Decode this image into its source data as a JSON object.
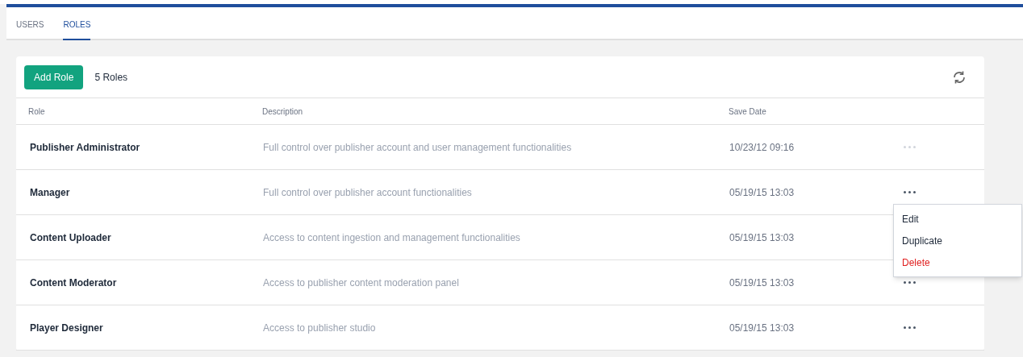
{
  "tabs": [
    {
      "label": "USERS",
      "selected": false
    },
    {
      "label": "ROLES",
      "selected": true
    }
  ],
  "toolbar": {
    "add_button": "Add Role",
    "count": "5 Roles"
  },
  "table": {
    "columns": [
      "Role",
      "Description",
      "Save Date"
    ],
    "rows": [
      {
        "role": "Publisher Administrator",
        "description": "Full control over publisher account and user management functionalities",
        "save_date": "10/23/12 09:16",
        "actions_disabled": true
      },
      {
        "role": "Manager",
        "description": "Full control over publisher account functionalities",
        "save_date": "05/19/15 13:03",
        "actions_disabled": false
      },
      {
        "role": "Content Uploader",
        "description": "Access to content ingestion and management functionalities",
        "save_date": "05/19/15 13:03"
      },
      {
        "role": "Content Moderator",
        "description": "Access to publisher content moderation panel",
        "save_date": "05/19/15 13:03",
        "actions_disabled": false
      },
      {
        "role": "Player Designer",
        "description": "Access to publisher studio",
        "save_date": "05/19/15 13:03",
        "actions_disabled": false
      }
    ]
  },
  "context_menu": [
    {
      "label": "Edit",
      "kind": "normal"
    },
    {
      "label": "Duplicate",
      "kind": "normal"
    },
    {
      "label": "Delete",
      "kind": "danger"
    }
  ]
}
